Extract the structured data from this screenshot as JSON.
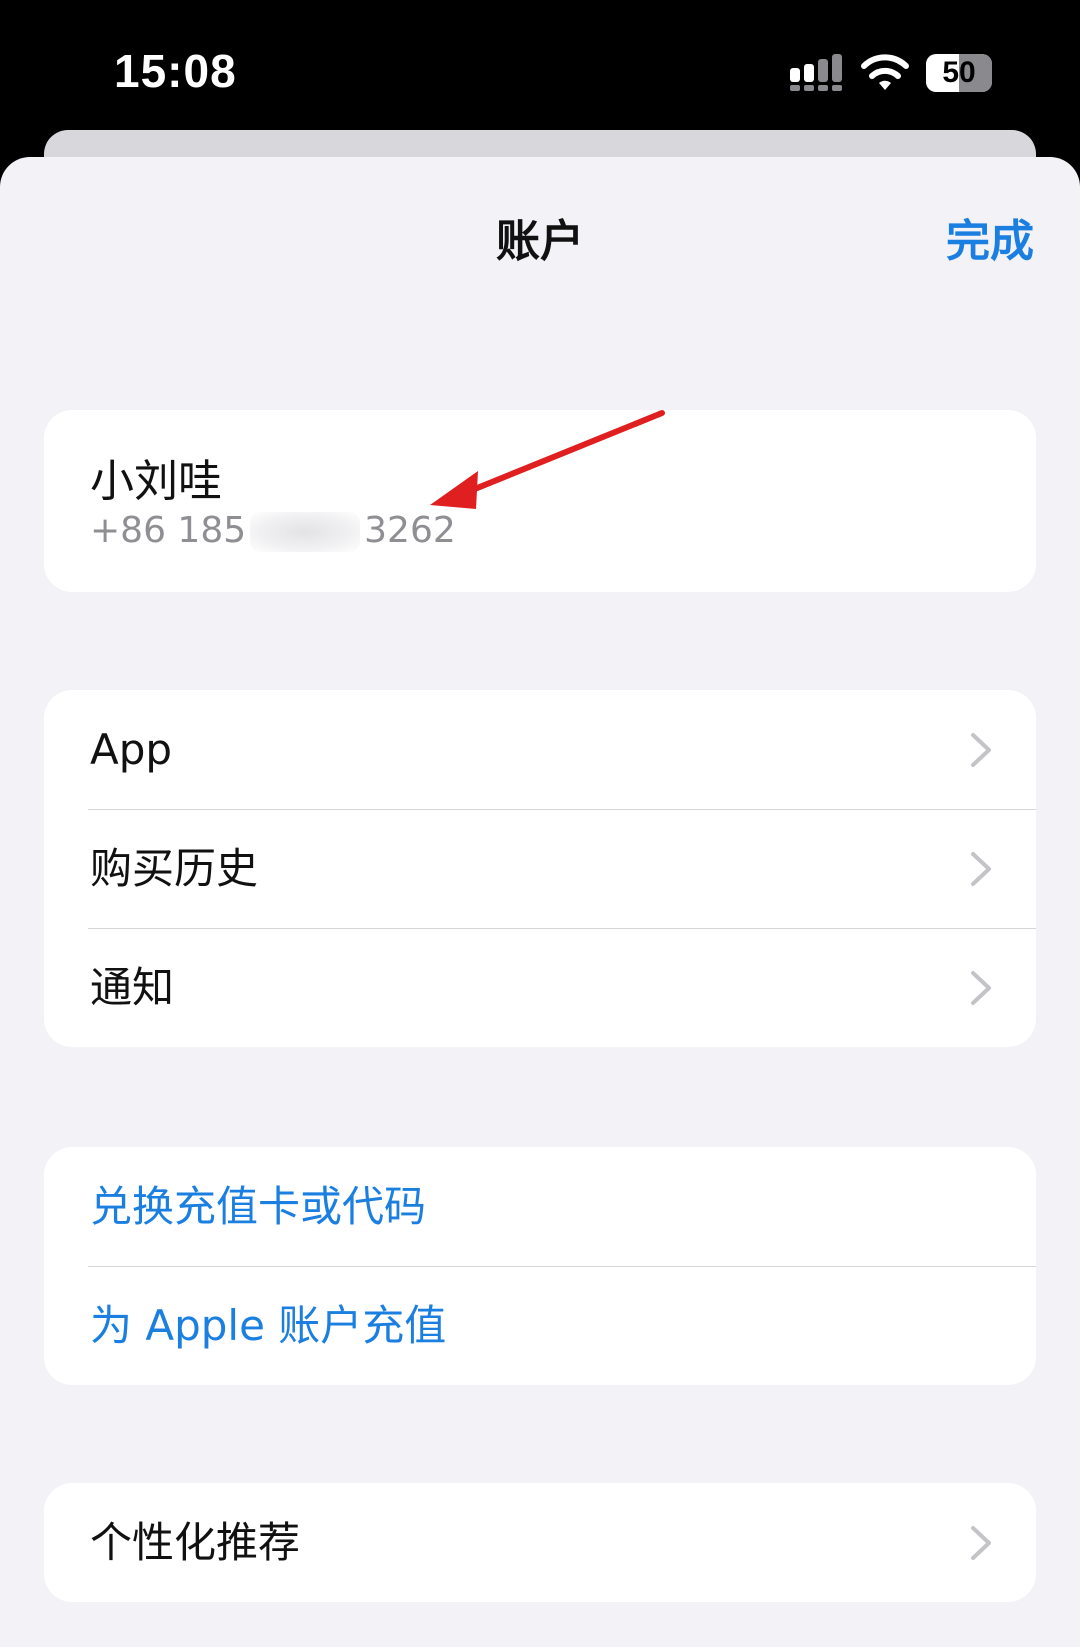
{
  "status_bar": {
    "time": "15:08",
    "battery": "50",
    "battery_level": 0.5,
    "icons": [
      "signal-icon",
      "wifi-icon",
      "battery-icon"
    ]
  },
  "nav": {
    "title": "账户",
    "done_label": "完成"
  },
  "account": {
    "name": "小刘哇",
    "phone_prefix": "+86 185",
    "phone_suffix": "3262"
  },
  "menu": {
    "items": [
      {
        "label": "App"
      },
      {
        "label": "购买历史"
      },
      {
        "label": "通知"
      }
    ]
  },
  "topup": {
    "items": [
      {
        "label": "兑换充值卡或代码"
      },
      {
        "label": "为 Apple 账户充值"
      }
    ]
  },
  "personal": {
    "label": "个性化推荐"
  },
  "colors": {
    "accent": "#1a7fe0",
    "background": "#f2f2f7",
    "annotation_arrow": "#e02020"
  }
}
